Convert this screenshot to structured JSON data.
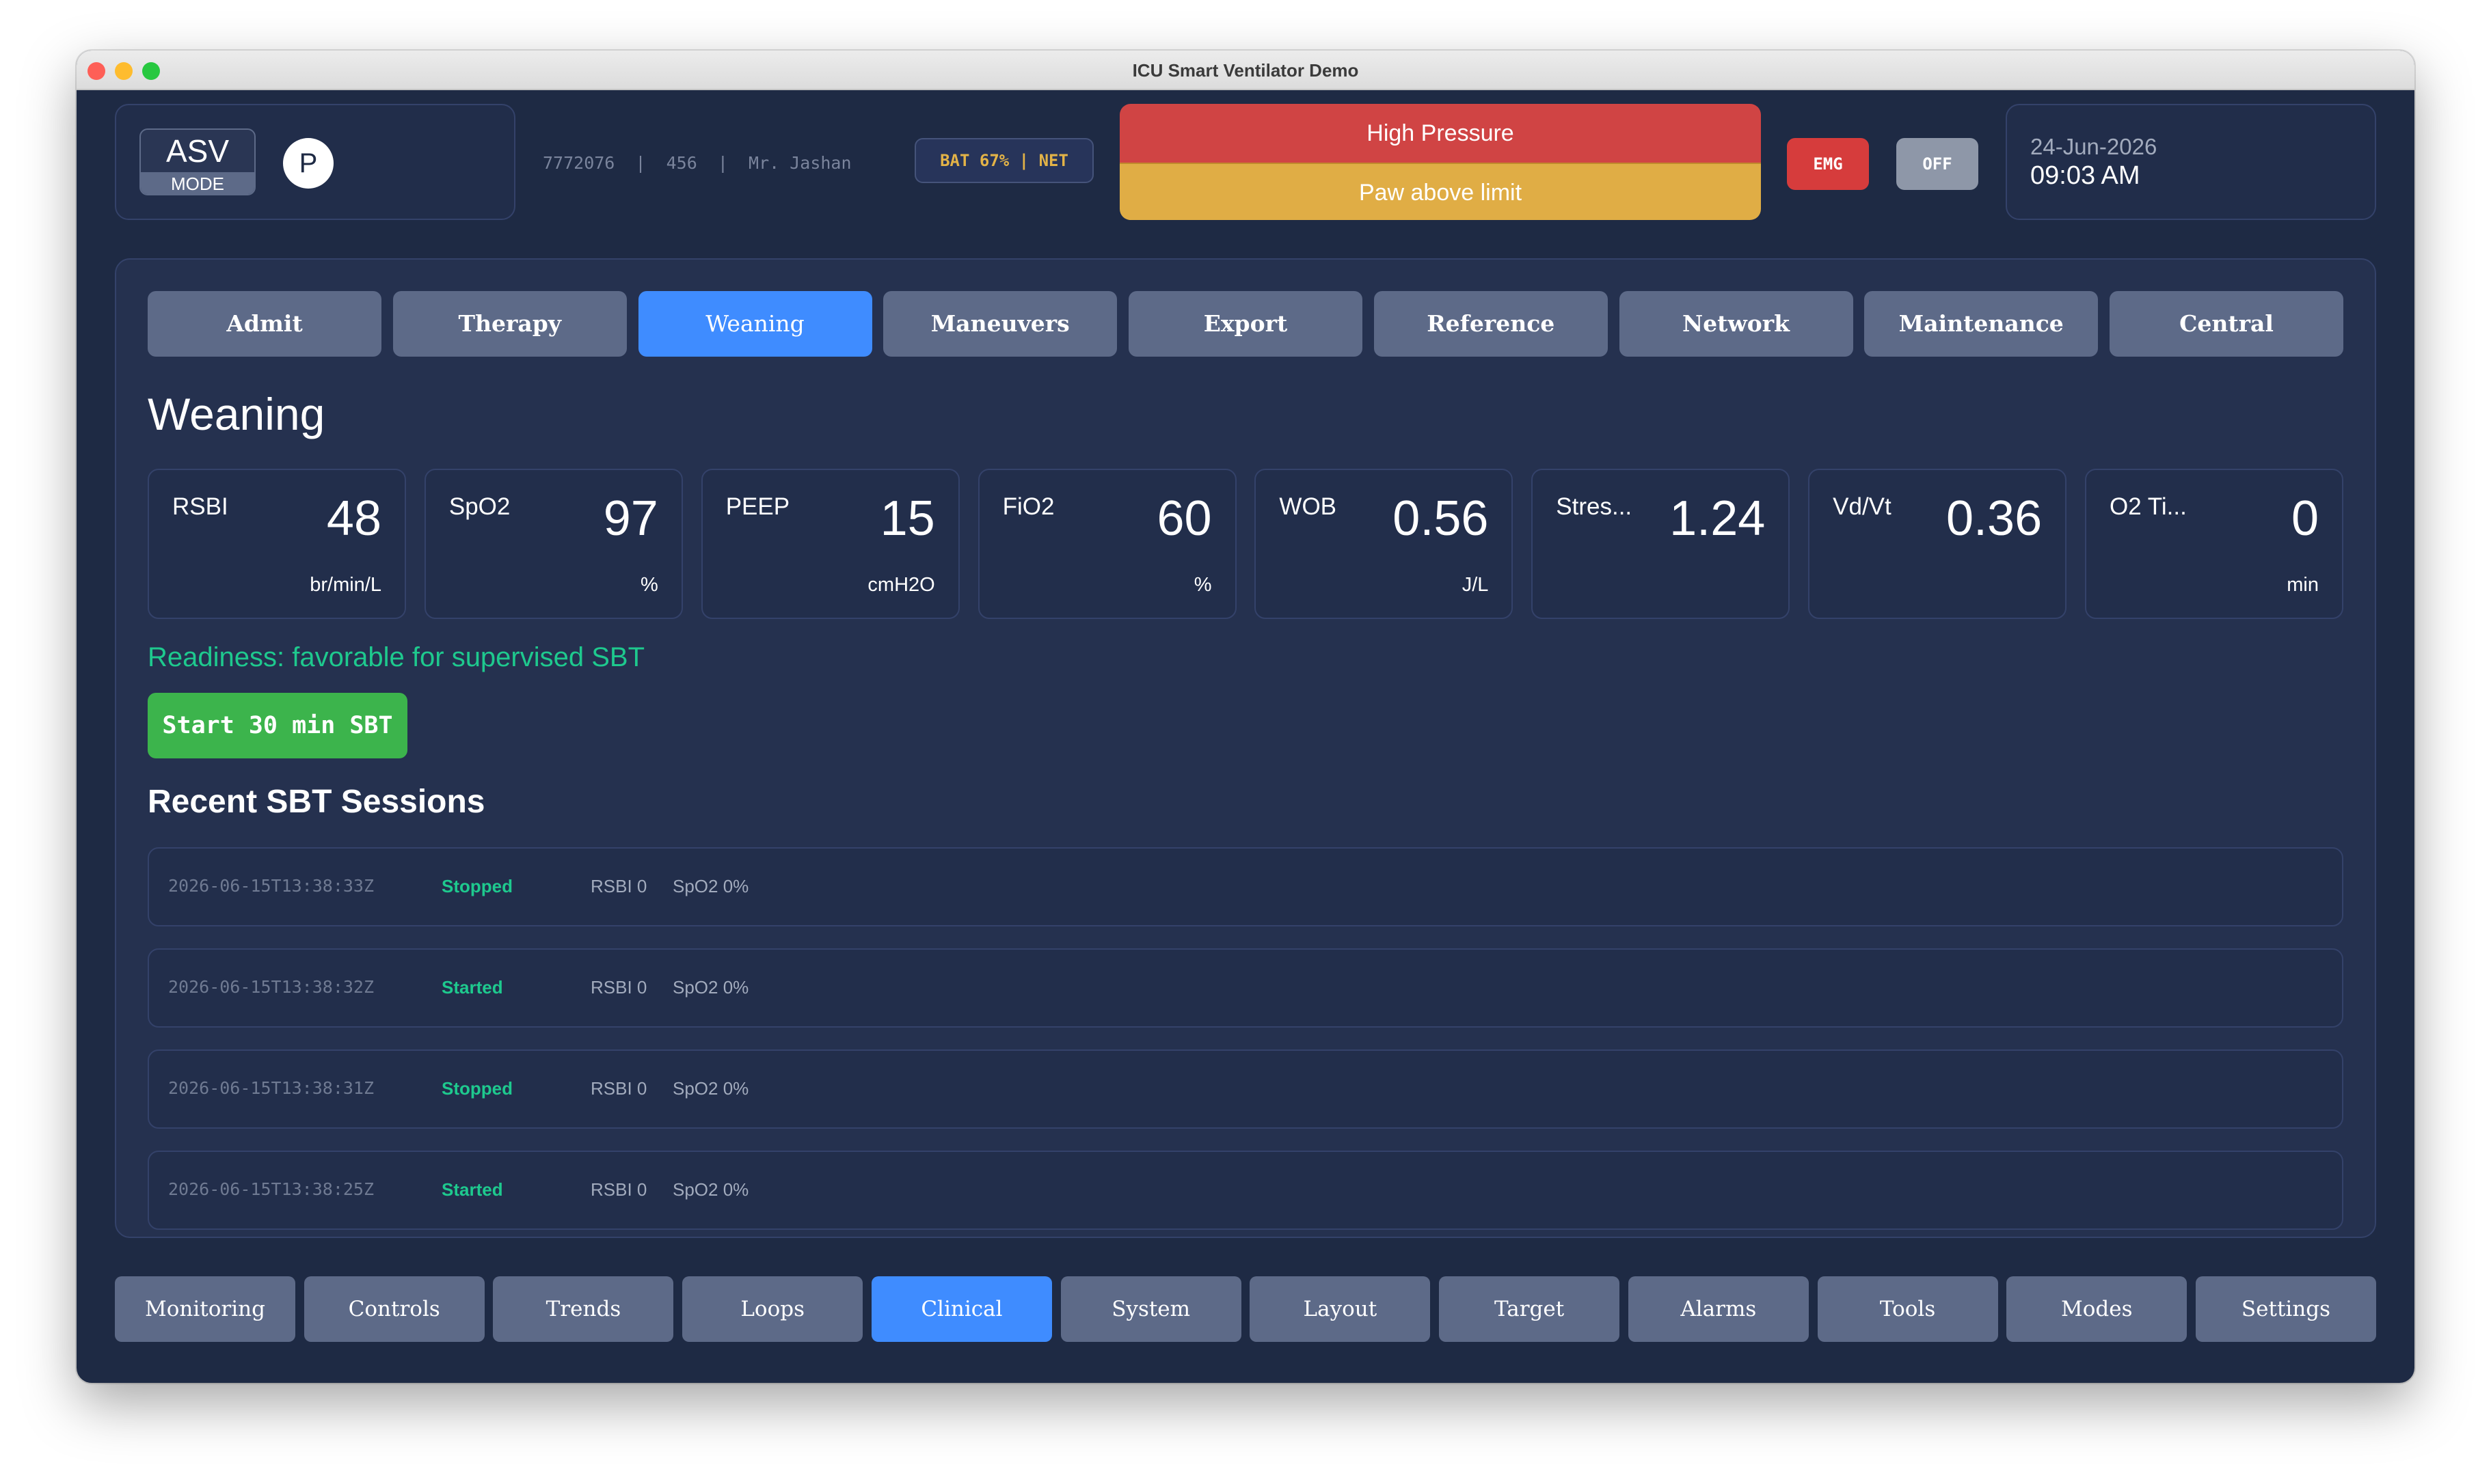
{
  "window": {
    "title": "ICU Smart Ventilator Demo"
  },
  "header": {
    "mode_code": "ASV",
    "mode_label": "MODE",
    "pressure_indicator": "P",
    "patient_info": "7772076  |  456  |  Mr. Jashan",
    "status": "BAT 67% | NET",
    "alarm_primary": "High Pressure",
    "alarm_secondary": "Paw above limit",
    "emg_label": "EMG",
    "off_label": "OFF",
    "date": "24-Jun-2026",
    "time": "09:03 AM"
  },
  "tabs": [
    {
      "label": "Admit"
    },
    {
      "label": "Therapy"
    },
    {
      "label": "Weaning"
    },
    {
      "label": "Maneuvers"
    },
    {
      "label": "Export"
    },
    {
      "label": "Reference"
    },
    {
      "label": "Network"
    },
    {
      "label": "Maintenance"
    },
    {
      "label": "Central"
    }
  ],
  "active_tab": "Weaning",
  "section": {
    "title": "Weaning"
  },
  "metrics": [
    {
      "name": "RSBI",
      "value": "48",
      "unit": "br/min/L"
    },
    {
      "name": "SpO2",
      "value": "97",
      "unit": "%"
    },
    {
      "name": "PEEP",
      "value": "15",
      "unit": "cmH2O"
    },
    {
      "name": "FiO2",
      "value": "60",
      "unit": "%"
    },
    {
      "name": "WOB",
      "value": "0.56",
      "unit": "J/L"
    },
    {
      "name": "Stres...",
      "value": "1.24",
      "unit": ""
    },
    {
      "name": "Vd/Vt",
      "value": "0.36",
      "unit": ""
    },
    {
      "name": "O2 Ti...",
      "value": "0",
      "unit": "min"
    }
  ],
  "readiness": "Readiness: favorable for supervised SBT",
  "sbt_button": "Start 30 min SBT",
  "recent": {
    "title": "Recent SBT Sessions",
    "sessions": [
      {
        "time": "2026-06-15T13:38:33Z",
        "status": "Stopped",
        "rsbi": "RSBI 0",
        "spo2": "SpO2 0%"
      },
      {
        "time": "2026-06-15T13:38:32Z",
        "status": "Started",
        "rsbi": "RSBI 0",
        "spo2": "SpO2 0%"
      },
      {
        "time": "2026-06-15T13:38:31Z",
        "status": "Stopped",
        "rsbi": "RSBI 0",
        "spo2": "SpO2 0%"
      },
      {
        "time": "2026-06-15T13:38:25Z",
        "status": "Started",
        "rsbi": "RSBI 0",
        "spo2": "SpO2 0%"
      }
    ]
  },
  "bottom_nav": [
    {
      "label": "Monitoring"
    },
    {
      "label": "Controls"
    },
    {
      "label": "Trends"
    },
    {
      "label": "Loops"
    },
    {
      "label": "Clinical"
    },
    {
      "label": "System"
    },
    {
      "label": "Layout"
    },
    {
      "label": "Target"
    },
    {
      "label": "Alarms"
    },
    {
      "label": "Tools"
    },
    {
      "label": "Modes"
    },
    {
      "label": "Settings"
    }
  ],
  "active_nav": "Clinical",
  "colors": {
    "background": "#1e2a44",
    "panel": "#25314f",
    "accent_active": "#3f8cff",
    "alarm_red": "#d04444",
    "alarm_yellow": "#e0ad45",
    "success_green": "#3cb44c",
    "readiness_text": "#1ec98e"
  }
}
